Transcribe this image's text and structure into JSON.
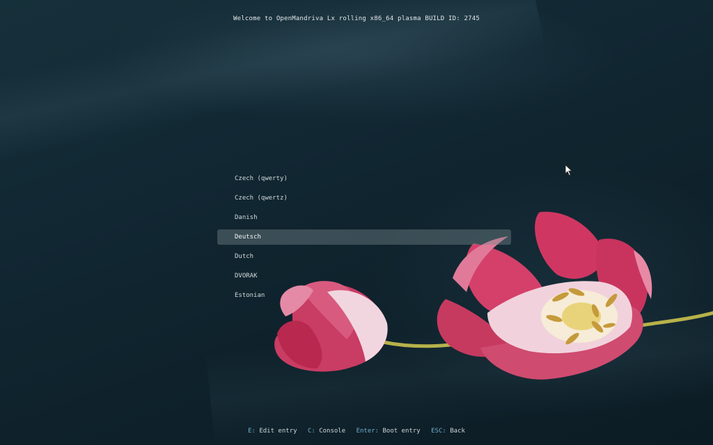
{
  "header": {
    "title": "Welcome to OpenMandriva Lx rolling x86_64 plasma BUILD ID: 2745"
  },
  "menu": {
    "items": [
      {
        "label": "Czech (qwerty)",
        "selected": false
      },
      {
        "label": "Czech (qwertz)",
        "selected": false
      },
      {
        "label": "Danish",
        "selected": false
      },
      {
        "label": "Deutsch",
        "selected": true
      },
      {
        "label": "Dutch",
        "selected": false
      },
      {
        "label": "DVORAK",
        "selected": false
      },
      {
        "label": "Estonian",
        "selected": false
      }
    ]
  },
  "footer": {
    "hints": [
      {
        "key": "E:",
        "action": "Edit entry"
      },
      {
        "key": "C:",
        "action": "Console"
      },
      {
        "key": "Enter:",
        "action": "Boot entry"
      },
      {
        "key": "ESC:",
        "action": "Back"
      }
    ]
  },
  "colors": {
    "background": "#102530",
    "selection": "#5e6c71",
    "key_accent": "#6fb0cf",
    "petal": "#c8345e",
    "petal_highlight": "#f3d4de"
  },
  "icons": {
    "pointer": "mouse-pointer-icon"
  }
}
